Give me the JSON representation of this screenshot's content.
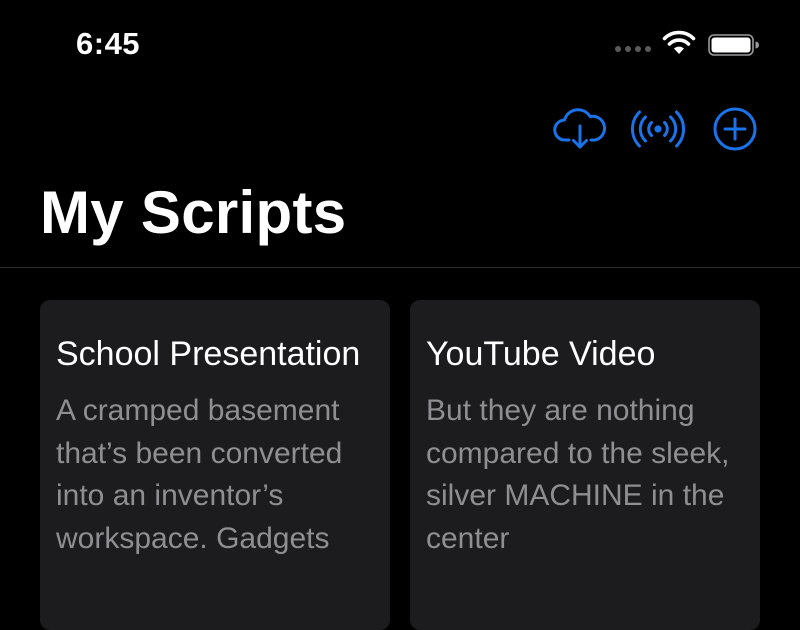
{
  "status_bar": {
    "time": "6:45"
  },
  "toolbar": {
    "icons": [
      "cloud-download-icon",
      "broadcast-icon",
      "add-circle-icon"
    ],
    "accent_color": "#1a73e8"
  },
  "page": {
    "title": "My Scripts"
  },
  "scripts": [
    {
      "title": "School Presentation",
      "preview": "A cramped basement that’s been converted into an inventor’s workspace. Gadgets"
    },
    {
      "title": "YouTube Video",
      "preview": "But they are nothing compared to the sleek, silver MACHINE in the center"
    }
  ],
  "colors": {
    "background": "#000000",
    "card": "#1c1c1e",
    "preview_text": "#8e8e93"
  }
}
